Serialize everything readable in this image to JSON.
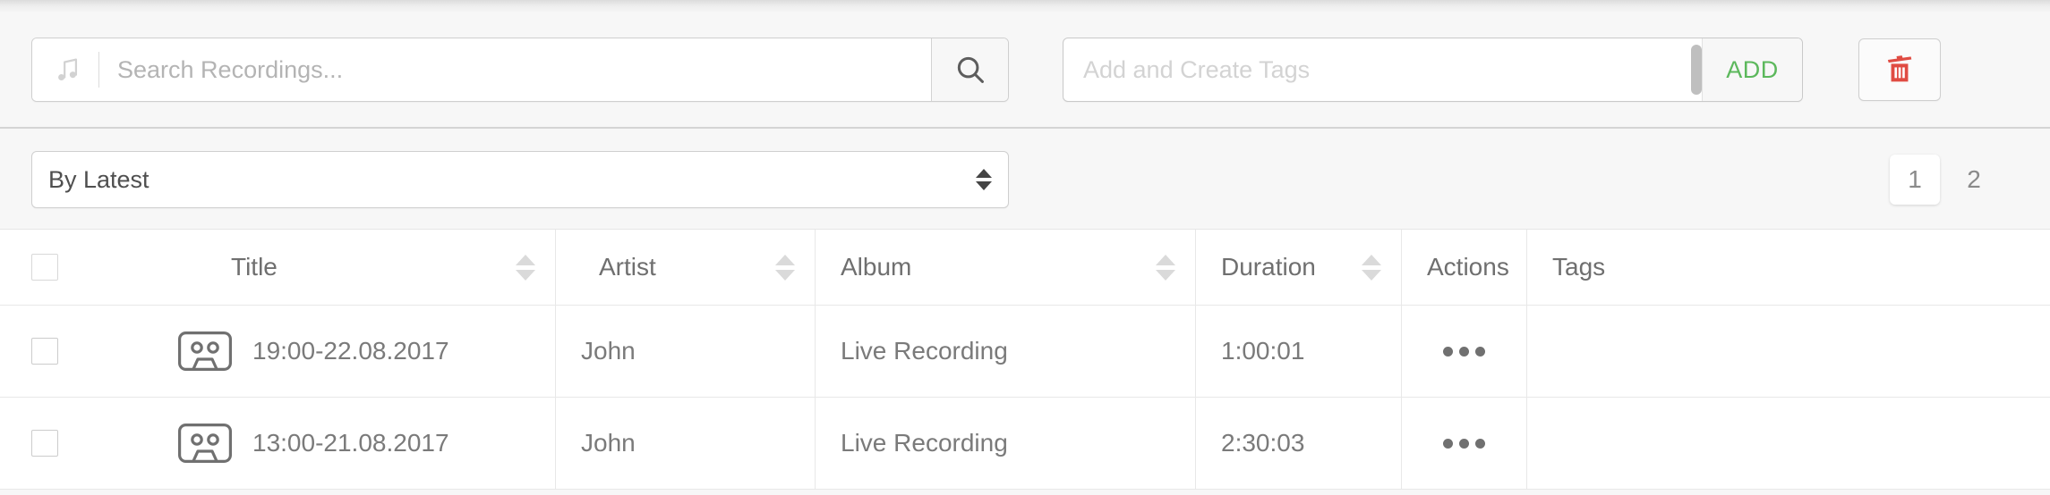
{
  "toolbar": {
    "search": {
      "icon": "music-note-icon",
      "placeholder": "Search Recordings...",
      "value": "",
      "button_icon": "search-icon"
    },
    "tags": {
      "placeholder": "Add and Create Tags",
      "value": "",
      "add_label": "ADD"
    },
    "delete": {
      "icon": "trash-icon",
      "color": "#e04c43"
    }
  },
  "sortbar": {
    "select": {
      "value": "By Latest",
      "options": [
        "By Latest"
      ],
      "stepper_icon": "updown-arrows-icon"
    },
    "pagination": {
      "pages": [
        {
          "label": "1",
          "active": true
        },
        {
          "label": "2",
          "active": false
        }
      ]
    }
  },
  "table": {
    "select_all_checkbox": false,
    "columns": [
      {
        "key": "checkbox",
        "label": "",
        "sortable": false
      },
      {
        "key": "title",
        "label": "Title",
        "sortable": true
      },
      {
        "key": "artist",
        "label": "Artist",
        "sortable": true
      },
      {
        "key": "album",
        "label": "Album",
        "sortable": true
      },
      {
        "key": "duration",
        "label": "Duration",
        "sortable": true
      },
      {
        "key": "actions",
        "label": "Actions",
        "sortable": false
      },
      {
        "key": "tags",
        "label": "Tags",
        "sortable": false
      }
    ],
    "rows": [
      {
        "checked": false,
        "icon": "cassette-icon",
        "title": "19:00-22.08.2017",
        "artist": "John",
        "album": "Live Recording",
        "duration": "1:00:01",
        "actions_icon": "ellipsis-icon",
        "tags": ""
      },
      {
        "checked": false,
        "icon": "cassette-icon",
        "title": "13:00-21.08.2017",
        "artist": "John",
        "album": "Live Recording",
        "duration": "2:30:03",
        "actions_icon": "ellipsis-icon",
        "tags": ""
      }
    ]
  },
  "colors": {
    "accent_green": "#5cb85c",
    "danger_red": "#e04c43",
    "page_bg": "#f7f7f7",
    "row_bg": "#ffffff"
  }
}
